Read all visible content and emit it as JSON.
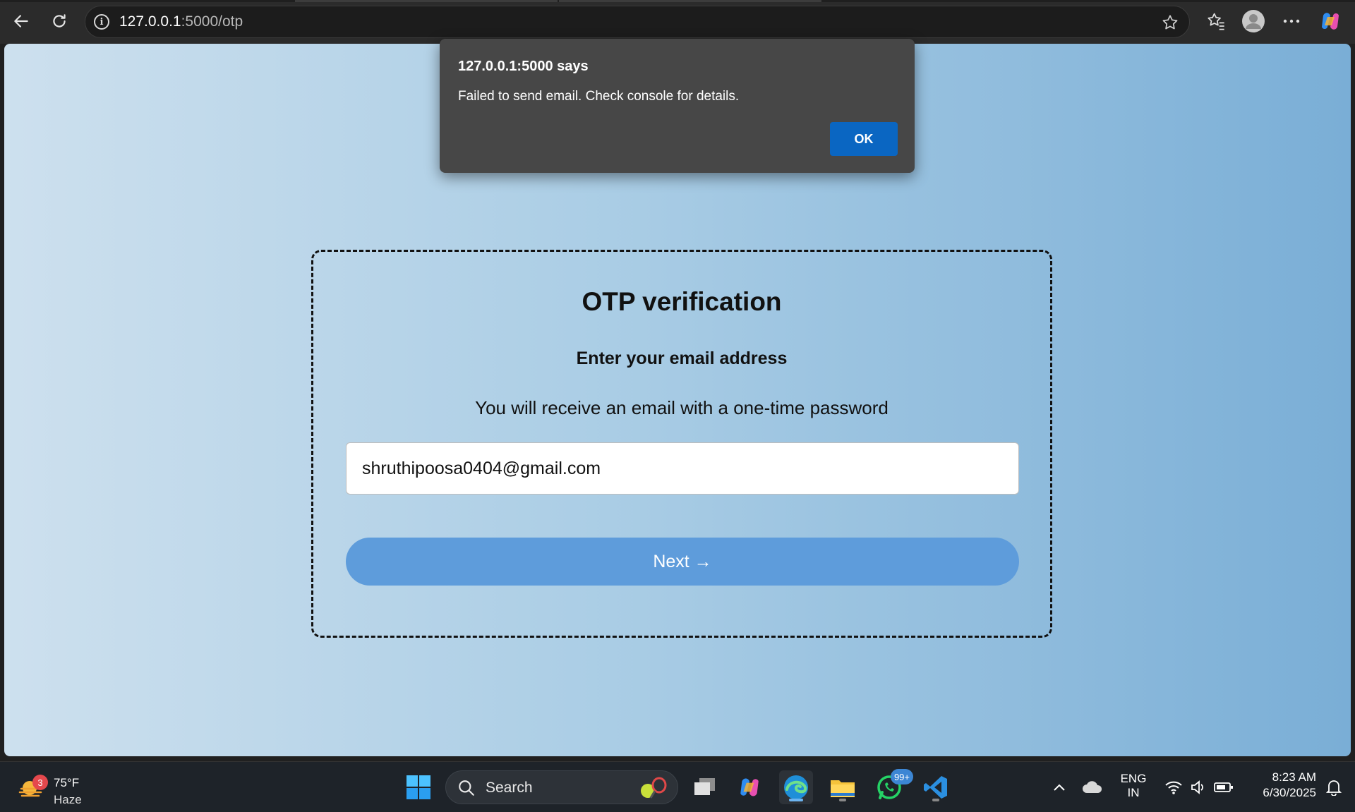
{
  "browser": {
    "url_host": "127.0.0.1",
    "url_path": ":5000/otp"
  },
  "page": {
    "title": "OTP verification",
    "subtitle": "Enter your email address",
    "description": "You will receive an email with a one-time password",
    "email_value": "shruthipoosa0404@gmail.com",
    "next_label": "Next →"
  },
  "dialog": {
    "title": "127.0.0.1:5000 says",
    "message": "Failed to send email. Check console for details.",
    "ok_label": "OK"
  },
  "taskbar": {
    "weather_temp": "75°F",
    "weather_condition": "Haze",
    "weather_badge": "3",
    "search_label": "Search",
    "whatsapp_badge": "99+",
    "language_line1": "ENG",
    "language_line2": "IN",
    "time": "8:23 AM",
    "date": "6/30/2025"
  },
  "colors": {
    "accent": "#5e9cdb",
    "dialog_ok": "#0a66c2"
  }
}
